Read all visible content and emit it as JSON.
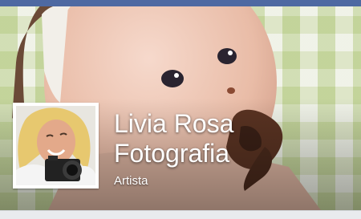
{
  "page": {
    "name_line1": "Livia Rosa",
    "name_line2": "Fotografia",
    "category": "Artista"
  },
  "images": {
    "cover": "cover-photo-baby-eating-chocolate-cake",
    "profile": "profile-photo-smiling-woman-with-camera"
  },
  "colors": {
    "top_bar": "#4e69a2",
    "text": "#ffffff",
    "backdrop_check": "#aac46e"
  }
}
